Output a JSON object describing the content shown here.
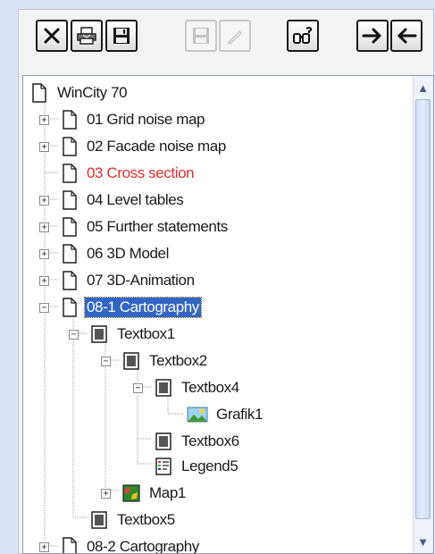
{
  "toolbar": {
    "buttons": [
      {
        "name": "delete-button",
        "icon": "close-x-icon",
        "enabled": true
      },
      {
        "name": "print-button",
        "icon": "printer-icon",
        "enabled": true
      },
      {
        "name": "save-button",
        "icon": "floppy-disk-icon",
        "enabled": true
      },
      {
        "name": "save-disabled-button",
        "icon": "floppy-disk-icon",
        "enabled": false
      },
      {
        "name": "edit-disabled-button",
        "icon": "pen-icon",
        "enabled": false
      },
      {
        "name": "find-button",
        "icon": "binoculars-help-icon",
        "enabled": true
      },
      {
        "name": "move-right-button",
        "icon": "arrow-right-icon",
        "enabled": true
      },
      {
        "name": "move-left-button",
        "icon": "arrow-left-icon",
        "enabled": true
      }
    ]
  },
  "tree": {
    "root": "WinCity 70",
    "items": [
      {
        "label": "01 Grid noise map",
        "icon": "document-icon",
        "expander": "+"
      },
      {
        "label": "02 Facade noise map",
        "icon": "document-icon",
        "expander": "+"
      },
      {
        "label": "03 Cross section",
        "icon": "document-icon",
        "expander": "",
        "color": "#e03030"
      },
      {
        "label": "04 Level tables",
        "icon": "document-icon",
        "expander": "+"
      },
      {
        "label": "05 Further statements",
        "icon": "document-icon",
        "expander": "+"
      },
      {
        "label": "06 3D Model",
        "icon": "document-icon",
        "expander": "+"
      },
      {
        "label": "07 3D-Animation",
        "icon": "document-icon",
        "expander": "+"
      },
      {
        "label": "08-1 Cartography",
        "icon": "document-icon",
        "expander": "−",
        "selected": true
      },
      {
        "label": "Textbox1",
        "icon": "textbox-icon",
        "expander": "−"
      },
      {
        "label": "Textbox2",
        "icon": "textbox-icon",
        "expander": "−"
      },
      {
        "label": "Textbox4",
        "icon": "textbox-icon",
        "expander": "−"
      },
      {
        "label": "Grafik1",
        "icon": "image-icon",
        "expander": ""
      },
      {
        "label": "Textbox6",
        "icon": "textbox-icon",
        "expander": ""
      },
      {
        "label": "Legend5",
        "icon": "legend-icon",
        "expander": ""
      },
      {
        "label": "Map1",
        "icon": "map-icon",
        "expander": "+"
      },
      {
        "label": "Textbox5",
        "icon": "textbox-icon",
        "expander": ""
      },
      {
        "label": "08-2 Cartography",
        "icon": "document-icon",
        "expander": "+"
      }
    ]
  },
  "scrollbar": {
    "up": "▲",
    "down": "▼"
  }
}
